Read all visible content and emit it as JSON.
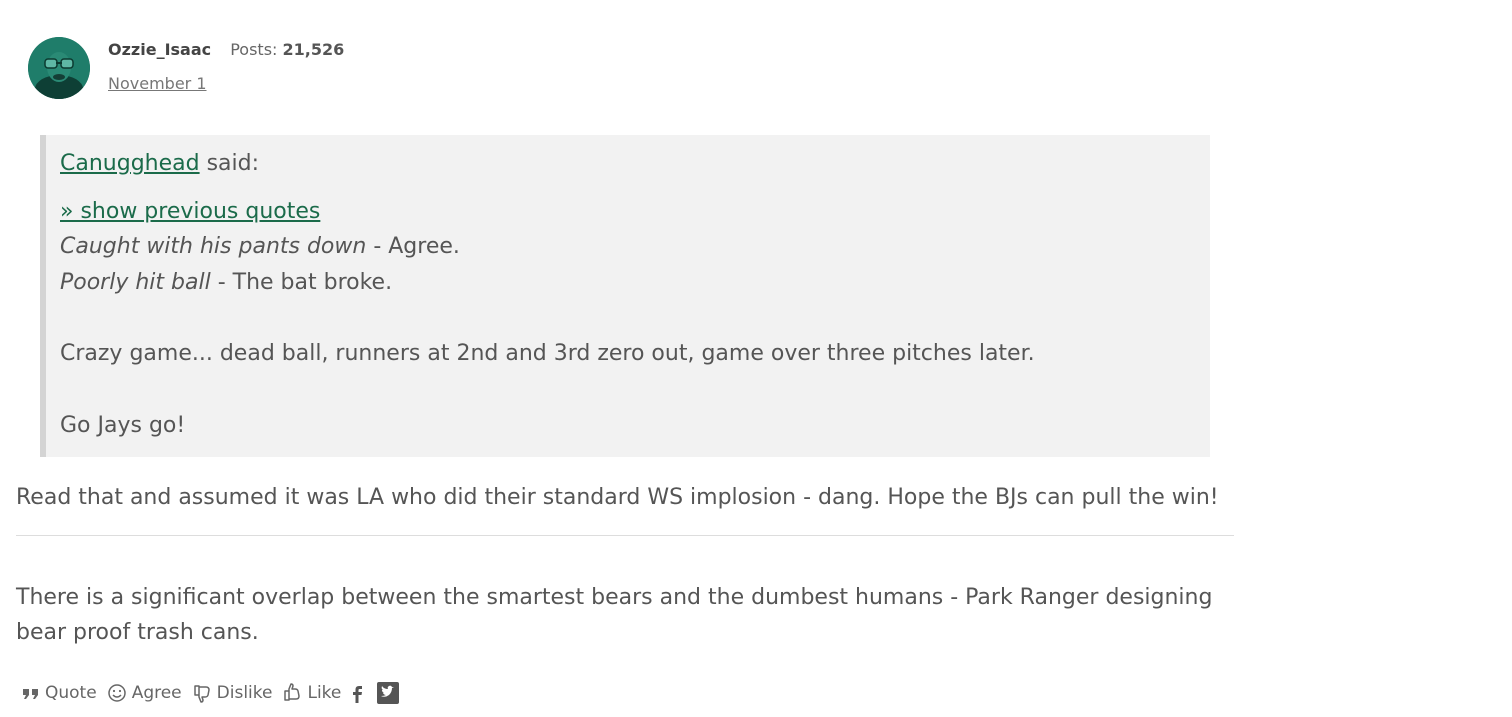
{
  "post": {
    "author": {
      "username": "Ozzie_Isaac",
      "posts_label": "Posts:",
      "posts_count": "21,526",
      "date": "November 1"
    },
    "quote": {
      "author": "Canugghead",
      "said": "said:",
      "show_previous": "» show previous quotes",
      "lines": [
        {
          "italic": "Caught with his pants down",
          "plain": " - Agree."
        },
        {
          "italic": "Poorly hit ball",
          "plain": " - The bat broke."
        }
      ],
      "paragraph1": "Crazy game... dead ball, runners at 2nd and 3rd zero out, game over three pitches later.",
      "paragraph2": "Go Jays go!"
    },
    "body": "Read that and assumed it was LA who did their standard WS implosion - dang.  Hope the BJs can pull the win!",
    "signature": "There is a significant overlap between the smartest bears and the dumbest humans - Park Ranger designing bear proof trash cans."
  },
  "reactions": {
    "quote": "Quote",
    "agree": "Agree",
    "dislike": "Dislike",
    "like": "Like"
  },
  "share": {
    "facebook_icon": "facebook-icon",
    "twitter_icon": "twitter-icon"
  },
  "colors": {
    "link": "#1b6b4a",
    "quote_bg": "#f2f2f2",
    "text": "#555555"
  }
}
